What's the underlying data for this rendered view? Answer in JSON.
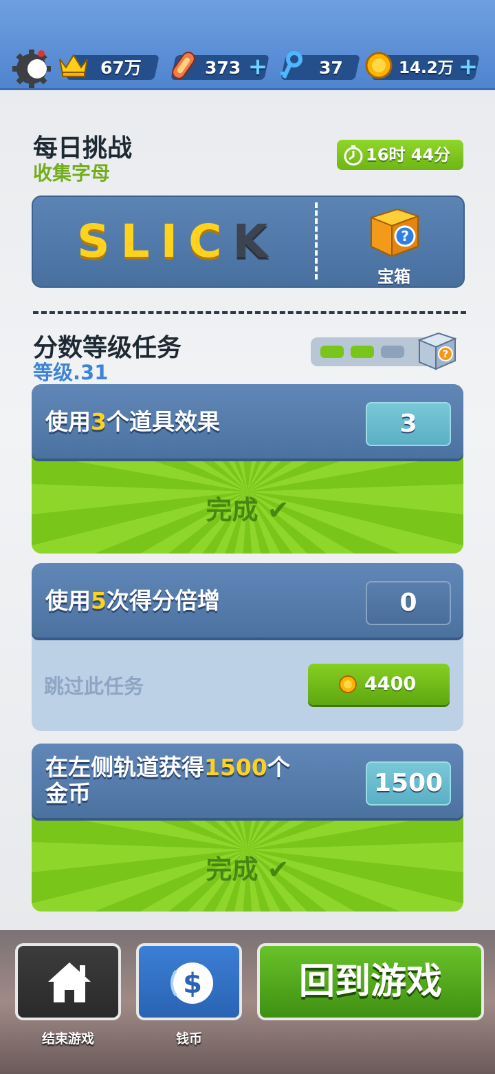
{
  "stats": {
    "crowns": "67万",
    "boards": "373",
    "keys": "37",
    "coins": "14.2万"
  },
  "daily": {
    "title": "每日挑战",
    "subtitle": "收集字母",
    "timer": "16时 44分",
    "letters_collected": "SLIC",
    "letters_missing": "K",
    "reward_label": "宝箱"
  },
  "score_missions": {
    "title": "分数等级任务",
    "level": "等级.31",
    "progress_filled": 2,
    "progress_total": 3
  },
  "missions": [
    {
      "pre": "使用",
      "num": "3",
      "post": "个道具效果",
      "count": "3",
      "status": "完成"
    },
    {
      "pre": "使用",
      "num": "5",
      "post": "次得分倍增",
      "count": "0",
      "skip_label": "跳过此任务",
      "skip_cost": "4400"
    },
    {
      "pre": "在左侧轨道获得",
      "num": "1500",
      "post": "个",
      "post2": "金币",
      "count": "1500",
      "status": "完成"
    }
  ],
  "bottom": {
    "end_game": "结束游戏",
    "coins": "钱币",
    "back_to_game": "回到游戏"
  },
  "colors": {
    "accent_green": "#7ac51a",
    "accent_blue": "#4f84cf",
    "highlight_yellow": "#ffd21e"
  }
}
